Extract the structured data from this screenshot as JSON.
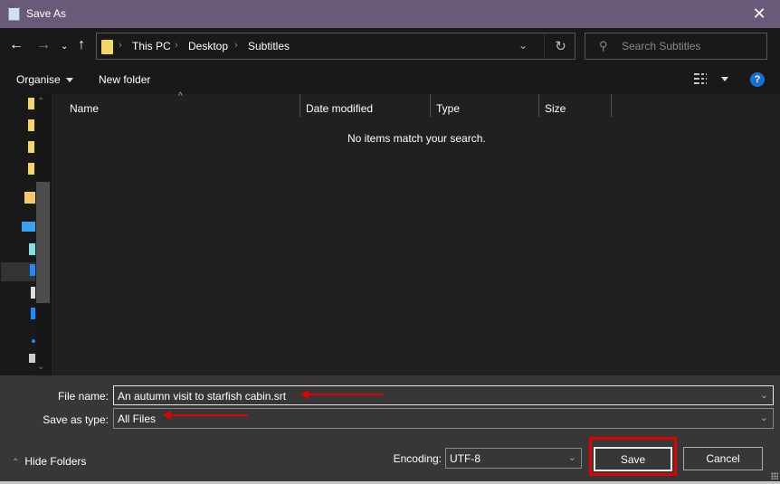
{
  "window": {
    "title": "Save As",
    "close_icon": "close-icon"
  },
  "navigation": {
    "back_icon": "arrow-left-icon",
    "forward_icon": "arrow-right-icon",
    "recent_icon": "chevron-down-icon",
    "up_icon": "arrow-up-icon",
    "breadcrumb": [
      "This PC",
      "Desktop",
      "Subtitles"
    ],
    "refresh_icon": "refresh-icon"
  },
  "search": {
    "placeholder": "Search Subtitles"
  },
  "toolbar": {
    "organise_label": "Organise",
    "new_folder_label": "New folder",
    "view_icon": "details-view-icon",
    "help_label": "?"
  },
  "file_list": {
    "columns": [
      "Name",
      "Date modified",
      "Type",
      "Size"
    ],
    "sort_column": "Name",
    "empty_message": "No items match your search."
  },
  "form": {
    "file_name_label": "File name:",
    "file_name_value": "An autumn visit to starfish cabin.srt",
    "save_type_label": "Save as type:",
    "save_type_value": "All Files",
    "encoding_label": "Encoding:",
    "encoding_value": "UTF-8"
  },
  "footer": {
    "hide_folders_label": "Hide Folders",
    "save_label": "Save",
    "cancel_label": "Cancel"
  },
  "annotations": {
    "highlight_color": "#e30000"
  }
}
